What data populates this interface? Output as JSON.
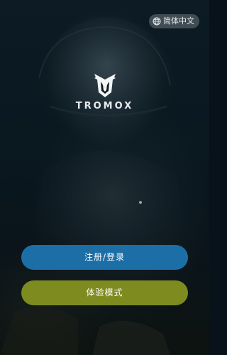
{
  "language_selector": {
    "label": "简体中文",
    "icon": "globe-icon"
  },
  "logo": {
    "brand_name": "TROMOX",
    "icon": "tromox-logo-icon"
  },
  "buttons": {
    "login_label": "注册/登录",
    "trial_label": "体验模式"
  },
  "colors": {
    "login_button": "#1c6fa6",
    "trial_button": "#7e8c1f",
    "background": "#0a1820"
  }
}
